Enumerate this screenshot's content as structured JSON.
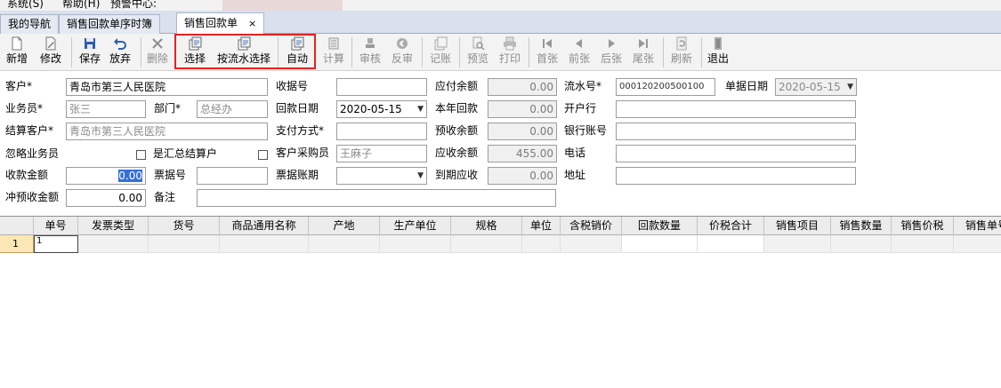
{
  "menu": {
    "items": [
      "系统(S)",
      "帮助(H)",
      "预警中心:"
    ]
  },
  "tabs": [
    {
      "label": "我的导航"
    },
    {
      "label": "销售回款单序时簿"
    },
    {
      "label": "销售回款单",
      "close": "×"
    }
  ],
  "toolbar": {
    "new": "新增",
    "edit": "修改",
    "save": "保存",
    "discard": "放弃",
    "delete": "删除",
    "select": "选择",
    "select_by_flow": "按流水选择",
    "auto": "自动",
    "calculate": "计算",
    "audit": "审核",
    "reverse_audit": "反审",
    "post": "记账",
    "preview": "预览",
    "print": "打印",
    "first": "首张",
    "prev": "前张",
    "next": "后张",
    "last": "尾张",
    "refresh": "刷新",
    "exit": "退出"
  },
  "form": {
    "customer_label": "客户*",
    "customer_value": "青岛市第三人民医院",
    "receipt_no_label": "收据号",
    "receipt_no_value": "",
    "payable_balance_label": "应付余额",
    "payable_balance_value": "0.00",
    "flow_no_label": "流水号*",
    "flow_no_value": "000120200500100",
    "doc_date_label": "单据日期",
    "doc_date_value": "2020-05-15",
    "salesman_label": "业务员*",
    "salesman_value": "张三",
    "dept_label": "部门*",
    "dept_value": "总经办",
    "return_date_label": "回款日期",
    "return_date_value": "2020-05-15",
    "year_return_label": "本年回款",
    "year_return_value": "0.00",
    "bank_label": "开户行",
    "bank_value": "",
    "settle_customer_label": "结算客户*",
    "settle_customer_value": "青岛市第三人民医院",
    "pay_method_label": "支付方式*",
    "pay_method_value": "",
    "prepaid_balance_label": "预收余额",
    "prepaid_balance_value": "0.00",
    "bank_account_label": "银行账号",
    "bank_account_value": "",
    "ignore_salesman_label": "忽略业务员",
    "is_summary_label": "是汇总结算户",
    "customer_buyer_label": "客户采购员",
    "customer_buyer_value": "王麻子",
    "receivable_balance_label": "应收余额",
    "receivable_balance_value": "455.00",
    "phone_label": "电话",
    "phone_value": "",
    "receipt_amount_label": "收款金额",
    "receipt_amount_value": "0.00",
    "bill_no_label": "票据号",
    "bill_no_value": "",
    "bill_period_label": "票据账期",
    "bill_period_value": "",
    "due_receivable_label": "到期应收",
    "due_receivable_value": "0.00",
    "address_label": "地址",
    "address_value": "",
    "offset_prepaid_label": "冲预收金额",
    "offset_prepaid_value": "0.00",
    "remark_label": "备注",
    "remark_value": ""
  },
  "grid": {
    "columns": [
      "单号",
      "发票类型",
      "货号",
      "商品通用名称",
      "产地",
      "生产单位",
      "规格",
      "单位",
      "含税销价",
      "回款数量",
      "价税合计",
      "销售项目",
      "销售数量",
      "销售价税",
      "销售单号"
    ],
    "rows": [
      {
        "row_no": "1",
        "cells": [
          "1",
          "",
          "",
          "",
          "",
          "",
          "",
          "",
          "",
          "",
          "",
          "",
          "",
          "",
          ""
        ]
      }
    ]
  }
}
